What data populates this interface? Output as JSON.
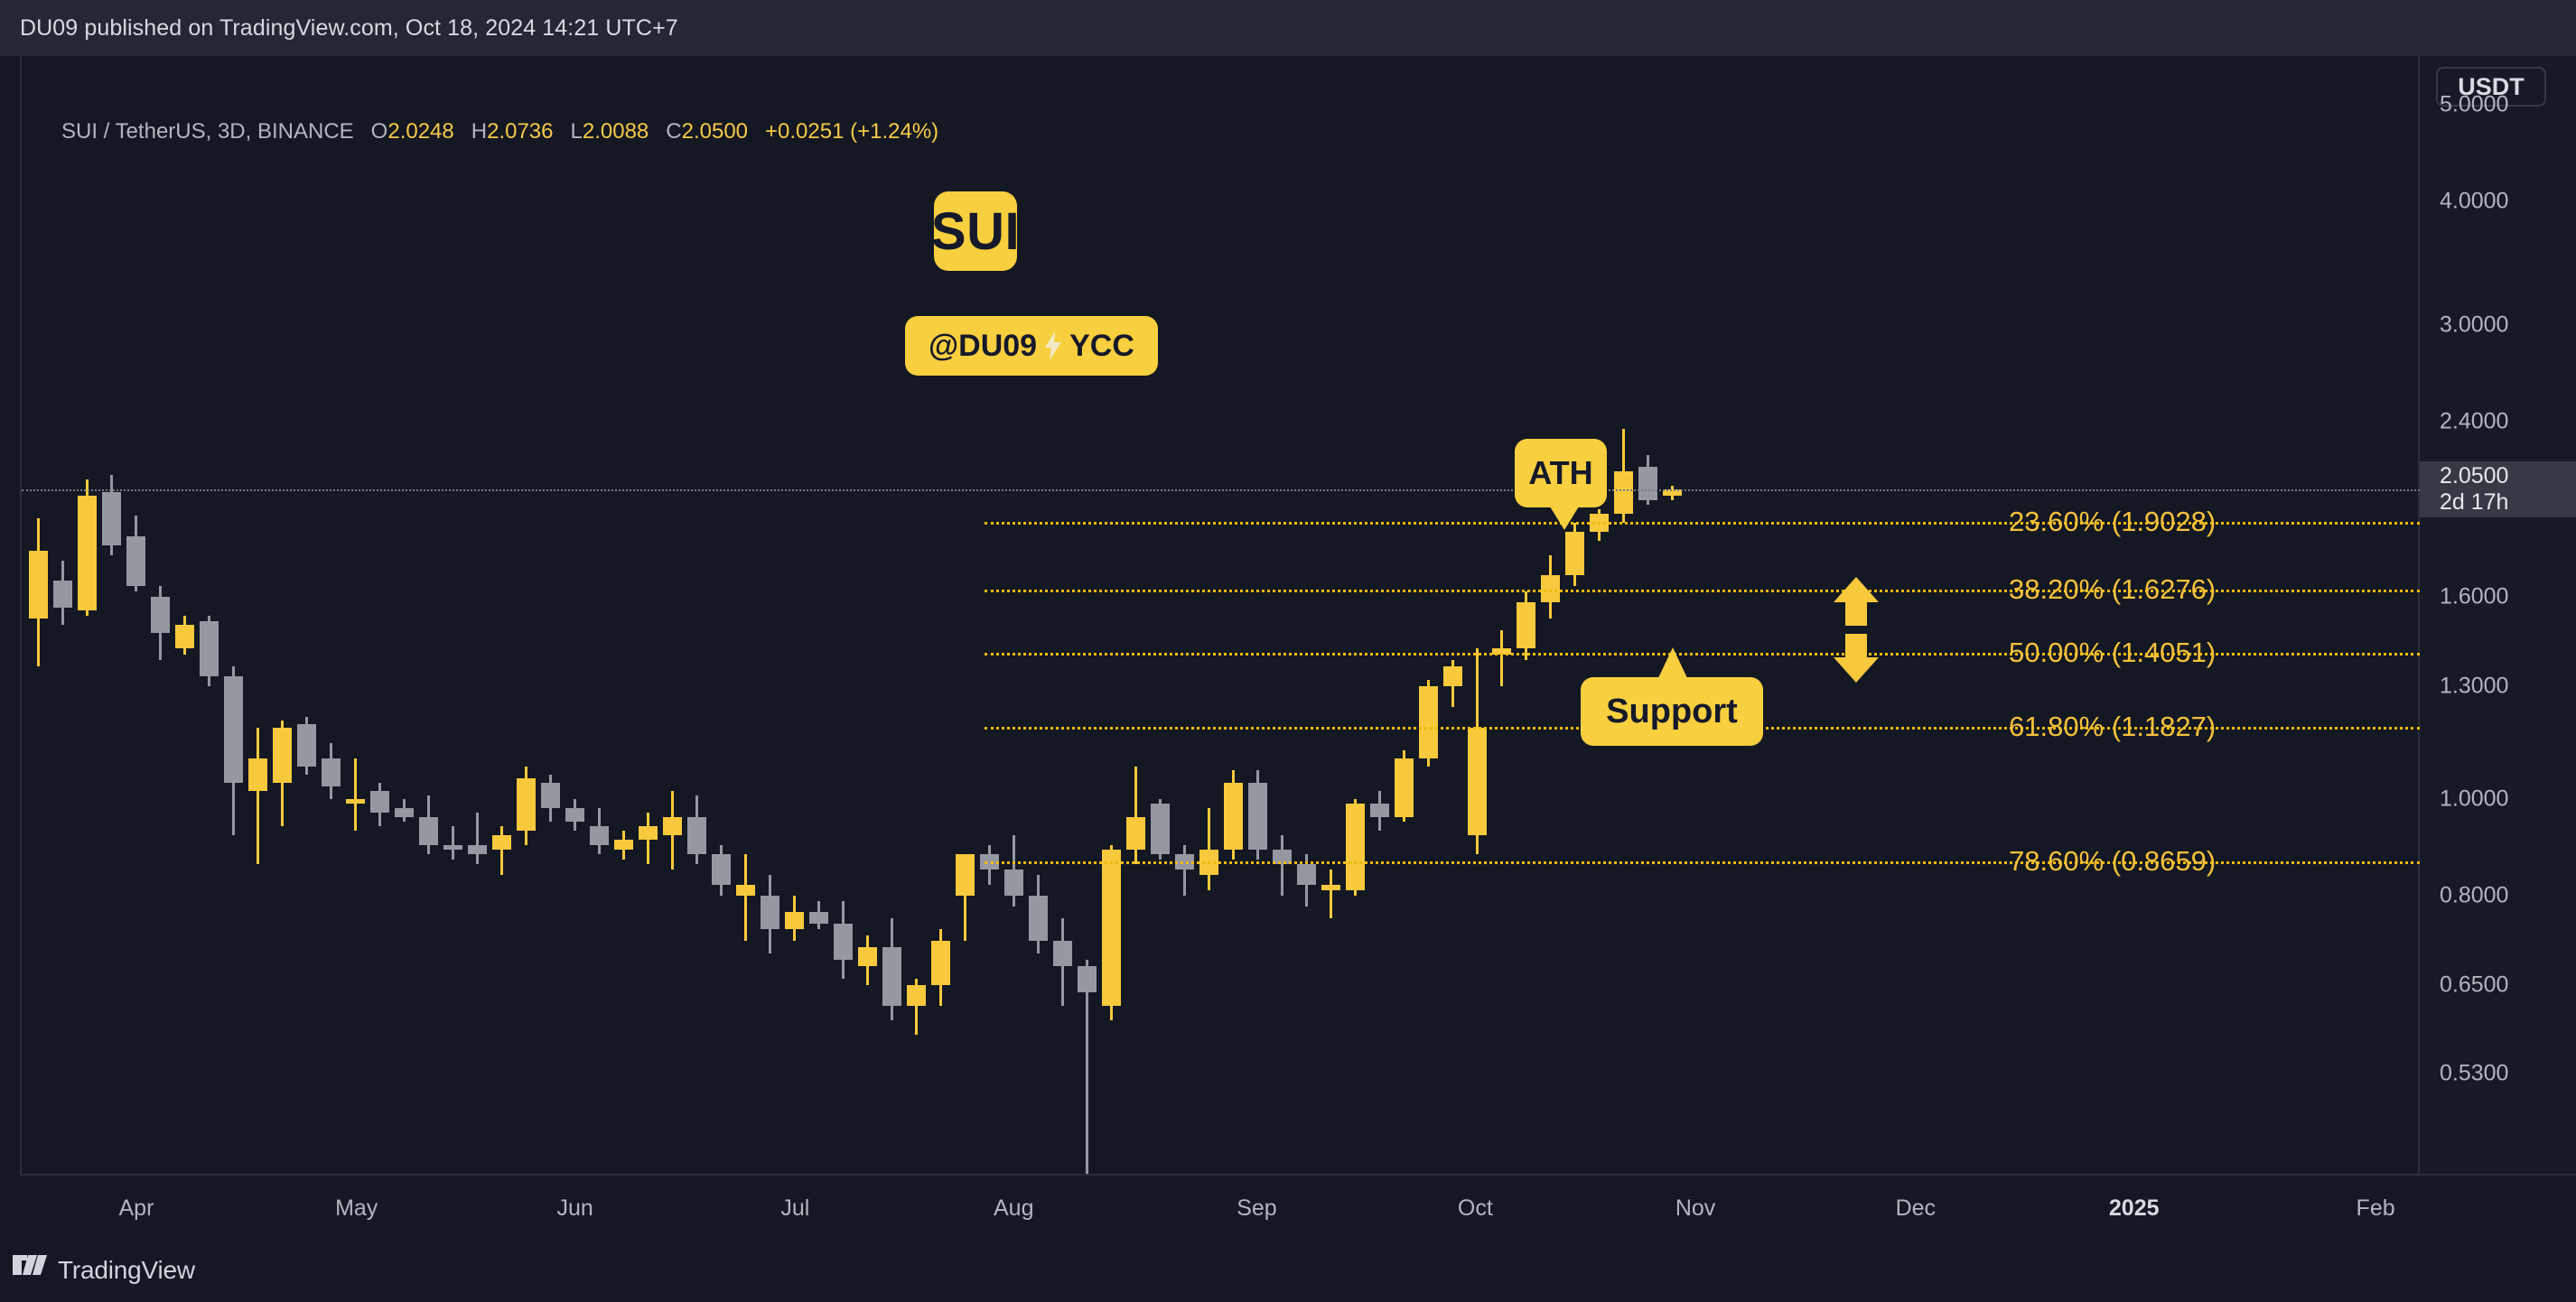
{
  "attribution": "DU09 published on TradingView.com, Oct 18, 2024 14:21 UTC+7",
  "legend": {
    "symbol": "SUI / TetherUS, 3D, BINANCE",
    "o_label": "O",
    "o_value": "2.0248",
    "h_label": "H",
    "h_value": "2.0736",
    "l_label": "L",
    "l_value": "2.0088",
    "c_label": "C",
    "c_value": "2.0500",
    "change": "+0.0251 (+1.24%)"
  },
  "price_scale": {
    "currency": "USDT",
    "current_price": "2.0500",
    "countdown": "2d 17h",
    "ticks": [
      "5.0000",
      "4.0000",
      "3.0000",
      "2.4000",
      "1.6000",
      "1.3000",
      "1.0000",
      "0.8000",
      "0.6500",
      "0.5300"
    ]
  },
  "time_scale": {
    "ticks": [
      "Apr",
      "May",
      "Jun",
      "Jul",
      "Aug",
      "Sep",
      "Oct",
      "Nov",
      "Dec",
      "2025",
      "Feb"
    ],
    "bold_tick": "2025"
  },
  "annotations": {
    "sui_badge": "SUI",
    "handle": "@DU09",
    "channel": "YCC",
    "ath": "ATH",
    "support": "Support",
    "arrow_up": "arrow-up-icon",
    "arrow_down": "arrow-down-icon",
    "bolt": "lightning-bolt-icon"
  },
  "watermark": "TradingView",
  "colors": {
    "background": "#141823",
    "up_candle": "#f8c93c",
    "down_candle": "#9598a1",
    "fib_yellow": "#f5c13b",
    "accent": "#f8cf3e",
    "axis_text": "#b2b5be"
  },
  "chart_data": {
    "type": "candlestick",
    "title": "SUI / TetherUS, 3D, BINANCE",
    "xlabel": "",
    "ylabel": "USDT",
    "ylim": [
      0.42,
      5.6
    ],
    "yscale": "log",
    "grid": false,
    "legend_position": "top-left",
    "x_ticks": [
      "Apr",
      "May",
      "Jun",
      "Jul",
      "Aug",
      "Sep",
      "Oct",
      "Nov",
      "Dec",
      "2025",
      "Feb"
    ],
    "y_ticks": [
      5.0,
      4.0,
      3.0,
      2.4,
      1.6,
      1.3,
      1.0,
      0.8,
      0.65,
      0.53
    ],
    "current_price": 2.05,
    "fib_levels": [
      {
        "label": "23.60% (1.9028)",
        "ratio": 23.6,
        "price": 1.9028
      },
      {
        "label": "38.20% (1.6276)",
        "ratio": 38.2,
        "price": 1.6276
      },
      {
        "label": "50.00% (1.4051)",
        "ratio": 50.0,
        "price": 1.4051
      },
      {
        "label": "61.80% (1.1827)",
        "ratio": 61.8,
        "price": 1.1827
      },
      {
        "label": "78.60% (0.8659)",
        "ratio": 78.6,
        "price": 0.8659
      }
    ],
    "candles": [
      {
        "t": "2024-03-28",
        "o": 1.78,
        "h": 1.92,
        "l": 1.36,
        "c": 1.52,
        "dir": "up"
      },
      {
        "t": "2024-03-31",
        "o": 1.66,
        "h": 1.74,
        "l": 1.5,
        "c": 1.56,
        "dir": "down"
      },
      {
        "t": "2024-04-03",
        "o": 1.55,
        "h": 2.1,
        "l": 1.53,
        "c": 2.02,
        "dir": "up"
      },
      {
        "t": "2024-04-06",
        "o": 2.04,
        "h": 2.12,
        "l": 1.76,
        "c": 1.8,
        "dir": "down"
      },
      {
        "t": "2024-04-09",
        "o": 1.84,
        "h": 1.93,
        "l": 1.62,
        "c": 1.64,
        "dir": "down"
      },
      {
        "t": "2024-04-12",
        "o": 1.6,
        "h": 1.64,
        "l": 1.38,
        "c": 1.47,
        "dir": "down"
      },
      {
        "t": "2024-04-15",
        "o": 1.42,
        "h": 1.53,
        "l": 1.4,
        "c": 1.5,
        "dir": "up"
      },
      {
        "t": "2024-04-18",
        "o": 1.51,
        "h": 1.53,
        "l": 1.3,
        "c": 1.33,
        "dir": "down"
      },
      {
        "t": "2024-04-21",
        "o": 1.33,
        "h": 1.36,
        "l": 0.92,
        "c": 1.04,
        "dir": "down"
      },
      {
        "t": "2024-04-24",
        "o": 1.02,
        "h": 1.18,
        "l": 0.86,
        "c": 1.1,
        "dir": "up"
      },
      {
        "t": "2024-04-27",
        "o": 1.04,
        "h": 1.2,
        "l": 0.94,
        "c": 1.18,
        "dir": "up"
      },
      {
        "t": "2024-04-30",
        "o": 1.19,
        "h": 1.21,
        "l": 1.06,
        "c": 1.08,
        "dir": "down"
      },
      {
        "t": "2024-05-03",
        "o": 1.1,
        "h": 1.14,
        "l": 1.0,
        "c": 1.03,
        "dir": "down"
      },
      {
        "t": "2024-05-06",
        "o": 0.99,
        "h": 1.1,
        "l": 0.93,
        "c": 1.0,
        "dir": "up"
      },
      {
        "t": "2024-05-09",
        "o": 1.02,
        "h": 1.04,
        "l": 0.94,
        "c": 0.97,
        "dir": "down"
      },
      {
        "t": "2024-05-12",
        "o": 0.98,
        "h": 1.0,
        "l": 0.95,
        "c": 0.96,
        "dir": "down"
      },
      {
        "t": "2024-05-15",
        "o": 0.96,
        "h": 1.01,
        "l": 0.88,
        "c": 0.9,
        "dir": "down"
      },
      {
        "t": "2024-05-18",
        "o": 0.9,
        "h": 0.94,
        "l": 0.87,
        "c": 0.89,
        "dir": "down"
      },
      {
        "t": "2024-05-21",
        "o": 0.9,
        "h": 0.97,
        "l": 0.86,
        "c": 0.88,
        "dir": "down"
      },
      {
        "t": "2024-05-24",
        "o": 0.89,
        "h": 0.94,
        "l": 0.84,
        "c": 0.92,
        "dir": "up"
      },
      {
        "t": "2024-05-27",
        "o": 0.93,
        "h": 1.08,
        "l": 0.9,
        "c": 1.05,
        "dir": "up"
      },
      {
        "t": "2024-05-30",
        "o": 1.04,
        "h": 1.06,
        "l": 0.95,
        "c": 0.98,
        "dir": "down"
      },
      {
        "t": "2024-06-02",
        "o": 0.98,
        "h": 1.0,
        "l": 0.93,
        "c": 0.95,
        "dir": "down"
      },
      {
        "t": "2024-06-05",
        "o": 0.94,
        "h": 0.98,
        "l": 0.88,
        "c": 0.9,
        "dir": "down"
      },
      {
        "t": "2024-06-08",
        "o": 0.89,
        "h": 0.93,
        "l": 0.87,
        "c": 0.91,
        "dir": "up"
      },
      {
        "t": "2024-06-11",
        "o": 0.91,
        "h": 0.97,
        "l": 0.86,
        "c": 0.94,
        "dir": "up"
      },
      {
        "t": "2024-06-14",
        "o": 0.92,
        "h": 1.02,
        "l": 0.85,
        "c": 0.96,
        "dir": "up"
      },
      {
        "t": "2024-06-17",
        "o": 0.96,
        "h": 1.01,
        "l": 0.86,
        "c": 0.88,
        "dir": "down"
      },
      {
        "t": "2024-06-20",
        "o": 0.88,
        "h": 0.9,
        "l": 0.8,
        "c": 0.82,
        "dir": "down"
      },
      {
        "t": "2024-06-23",
        "o": 0.82,
        "h": 0.88,
        "l": 0.72,
        "c": 0.8,
        "dir": "up"
      },
      {
        "t": "2024-06-26",
        "o": 0.8,
        "h": 0.84,
        "l": 0.7,
        "c": 0.74,
        "dir": "down"
      },
      {
        "t": "2024-06-29",
        "o": 0.74,
        "h": 0.8,
        "l": 0.72,
        "c": 0.77,
        "dir": "up"
      },
      {
        "t": "2024-07-02",
        "o": 0.77,
        "h": 0.79,
        "l": 0.74,
        "c": 0.75,
        "dir": "down"
      },
      {
        "t": "2024-07-05",
        "o": 0.75,
        "h": 0.79,
        "l": 0.66,
        "c": 0.69,
        "dir": "down"
      },
      {
        "t": "2024-07-08",
        "o": 0.68,
        "h": 0.73,
        "l": 0.65,
        "c": 0.71,
        "dir": "up"
      },
      {
        "t": "2024-07-11",
        "o": 0.71,
        "h": 0.76,
        "l": 0.6,
        "c": 0.62,
        "dir": "down"
      },
      {
        "t": "2024-07-14",
        "o": 0.62,
        "h": 0.66,
        "l": 0.58,
        "c": 0.65,
        "dir": "up"
      },
      {
        "t": "2024-07-17",
        "o": 0.65,
        "h": 0.74,
        "l": 0.62,
        "c": 0.72,
        "dir": "up"
      },
      {
        "t": "2024-07-20",
        "o": 0.8,
        "h": 0.85,
        "l": 0.72,
        "c": 0.88,
        "dir": "up"
      },
      {
        "t": "2024-07-23",
        "o": 0.88,
        "h": 0.9,
        "l": 0.82,
        "c": 0.85,
        "dir": "down"
      },
      {
        "t": "2024-07-26",
        "o": 0.85,
        "h": 0.92,
        "l": 0.78,
        "c": 0.8,
        "dir": "down"
      },
      {
        "t": "2024-07-29",
        "o": 0.8,
        "h": 0.84,
        "l": 0.7,
        "c": 0.72,
        "dir": "down"
      },
      {
        "t": "2024-08-01",
        "o": 0.72,
        "h": 0.76,
        "l": 0.62,
        "c": 0.68,
        "dir": "down"
      },
      {
        "t": "2024-08-04",
        "o": 0.68,
        "h": 0.69,
        "l": 0.38,
        "c": 0.64,
        "dir": "down"
      },
      {
        "t": "2024-08-07",
        "o": 0.62,
        "h": 0.9,
        "l": 0.6,
        "c": 0.89,
        "dir": "up"
      },
      {
        "t": "2024-08-10",
        "o": 0.89,
        "h": 1.08,
        "l": 0.86,
        "c": 0.96,
        "dir": "up"
      },
      {
        "t": "2024-08-13",
        "o": 0.99,
        "h": 1.0,
        "l": 0.87,
        "c": 0.88,
        "dir": "down"
      },
      {
        "t": "2024-08-16",
        "o": 0.88,
        "h": 0.9,
        "l": 0.8,
        "c": 0.85,
        "dir": "down"
      },
      {
        "t": "2024-08-19",
        "o": 0.84,
        "h": 0.98,
        "l": 0.81,
        "c": 0.89,
        "dir": "up"
      },
      {
        "t": "2024-08-22",
        "o": 0.89,
        "h": 1.07,
        "l": 0.87,
        "c": 1.04,
        "dir": "up"
      },
      {
        "t": "2024-08-25",
        "o": 1.04,
        "h": 1.07,
        "l": 0.87,
        "c": 0.89,
        "dir": "down"
      },
      {
        "t": "2024-08-28",
        "o": 0.89,
        "h": 0.92,
        "l": 0.8,
        "c": 0.86,
        "dir": "down"
      },
      {
        "t": "2024-08-31",
        "o": 0.86,
        "h": 0.88,
        "l": 0.78,
        "c": 0.82,
        "dir": "down"
      },
      {
        "t": "2024-09-03",
        "o": 0.82,
        "h": 0.85,
        "l": 0.76,
        "c": 0.81,
        "dir": "up"
      },
      {
        "t": "2024-09-06",
        "o": 0.81,
        "h": 1.0,
        "l": 0.8,
        "c": 0.99,
        "dir": "up"
      },
      {
        "t": "2024-09-09",
        "o": 0.99,
        "h": 1.02,
        "l": 0.93,
        "c": 0.96,
        "dir": "down"
      },
      {
        "t": "2024-09-12",
        "o": 0.96,
        "h": 1.12,
        "l": 0.95,
        "c": 1.1,
        "dir": "up"
      },
      {
        "t": "2024-09-15",
        "o": 1.1,
        "h": 1.32,
        "l": 1.08,
        "c": 1.3,
        "dir": "up"
      },
      {
        "t": "2024-09-18",
        "o": 1.3,
        "h": 1.38,
        "l": 1.24,
        "c": 1.36,
        "dir": "up"
      },
      {
        "t": "2024-09-21",
        "o": 1.18,
        "h": 1.42,
        "l": 0.88,
        "c": 0.92,
        "dir": "up"
      },
      {
        "t": "2024-09-24",
        "o": 1.4,
        "h": 1.48,
        "l": 1.3,
        "c": 1.42,
        "dir": "up"
      },
      {
        "t": "2024-09-27",
        "o": 1.42,
        "h": 1.62,
        "l": 1.38,
        "c": 1.58,
        "dir": "up"
      },
      {
        "t": "2024-09-30",
        "o": 1.58,
        "h": 1.76,
        "l": 1.52,
        "c": 1.68,
        "dir": "up"
      },
      {
        "t": "2024-10-03",
        "o": 1.68,
        "h": 1.9,
        "l": 1.64,
        "c": 1.86,
        "dir": "up"
      },
      {
        "t": "2024-10-06",
        "o": 1.86,
        "h": 1.96,
        "l": 1.82,
        "c": 1.94,
        "dir": "up"
      },
      {
        "t": "2024-10-09",
        "o": 1.94,
        "h": 2.36,
        "l": 1.9,
        "c": 2.14,
        "dir": "up"
      },
      {
        "t": "2024-10-12",
        "o": 2.16,
        "h": 2.22,
        "l": 1.98,
        "c": 2.0,
        "dir": "down"
      },
      {
        "t": "2024-10-15",
        "o": 2.02,
        "h": 2.07,
        "l": 2.0,
        "c": 2.05,
        "dir": "up"
      }
    ]
  }
}
